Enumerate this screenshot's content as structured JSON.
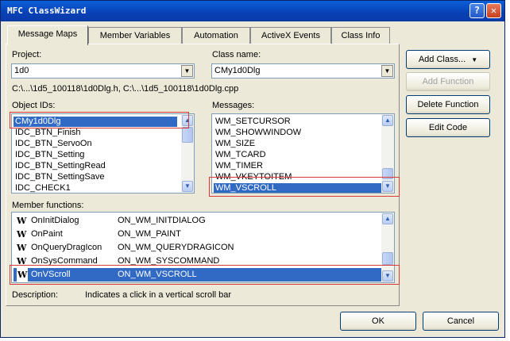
{
  "window": {
    "title": "MFC ClassWizard"
  },
  "tabs": [
    "Message Maps",
    "Member Variables",
    "Automation",
    "ActiveX Events",
    "Class Info"
  ],
  "project": {
    "label": "Project:",
    "value": "1d0"
  },
  "class_name": {
    "label": "Class name:",
    "value": "CMy1d0Dlg"
  },
  "file_path": "C:\\...\\1d5_100118\\1d0Dlg.h, C:\\...\\1d5_100118\\1d0Dlg.cpp",
  "object_ids": {
    "label": "Object IDs:",
    "items": [
      "CMy1d0Dlg",
      "IDC_BTN_Finish",
      "IDC_BTN_ServoOn",
      "IDC_BTN_Setting",
      "IDC_BTN_SettingRead",
      "IDC_BTN_SettingSave",
      "IDC_CHECK1"
    ]
  },
  "messages": {
    "label": "Messages:",
    "items": [
      "WM_SETCURSOR",
      "WM_SHOWWINDOW",
      "WM_SIZE",
      "WM_TCARD",
      "WM_TIMER",
      "WM_VKEYTOITEM",
      "WM_VSCROLL"
    ]
  },
  "member_functions": {
    "label": "Member functions:",
    "items": [
      {
        "badge": "W",
        "name": "OnInitDialog",
        "message": "ON_WM_INITDIALOG"
      },
      {
        "badge": "W",
        "name": "OnPaint",
        "message": "ON_WM_PAINT"
      },
      {
        "badge": "W",
        "name": "OnQueryDragIcon",
        "message": "ON_WM_QUERYDRAGICON"
      },
      {
        "badge": "W",
        "name": "OnSysCommand",
        "message": "ON_WM_SYSCOMMAND"
      },
      {
        "badge": "W",
        "name": "OnVScroll",
        "message": "ON_WM_VSCROLL"
      }
    ]
  },
  "description": {
    "label": "Description:",
    "text": "Indicates a click in a vertical scroll bar"
  },
  "buttons": {
    "add_class": "Add Class...",
    "add_function": "Add Function",
    "delete_function": "Delete Function",
    "edit_code": "Edit Code",
    "ok": "OK",
    "cancel": "Cancel"
  },
  "icons": {
    "help": "?",
    "close": "✕",
    "dropdown": "▼",
    "scroll_up": "▲",
    "scroll_down": "▼"
  },
  "colors": {
    "selection": "#316ac5",
    "highlight_box": "#d83a3a",
    "titlebar": "#0842b8"
  }
}
